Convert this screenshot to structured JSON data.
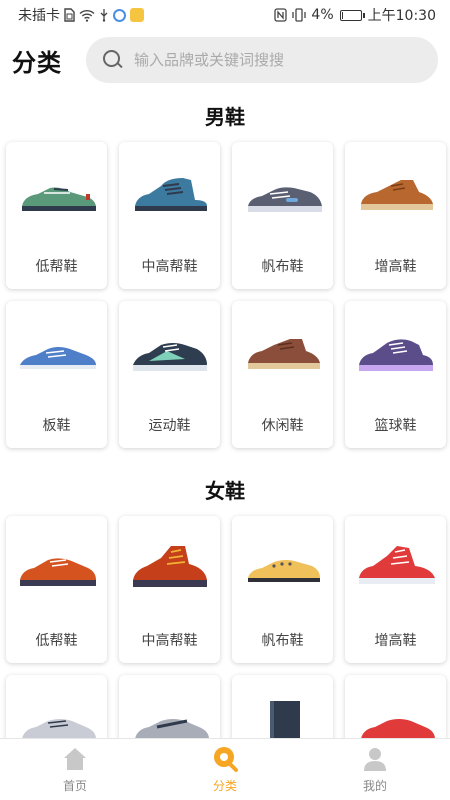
{
  "status_bar": {
    "carrier": "未插卡",
    "battery_pct": "4%",
    "battery_level": 0.04,
    "time": "上午10:30"
  },
  "header": {
    "title": "分类",
    "search_placeholder": "输入品牌或关键词搜搜"
  },
  "sections": [
    {
      "title": "男鞋",
      "items": [
        {
          "label": "低帮鞋",
          "icon": "low-top-sneaker-icon"
        },
        {
          "label": "中高帮鞋",
          "icon": "mid-top-sneaker-icon"
        },
        {
          "label": "帆布鞋",
          "icon": "canvas-shoe-icon"
        },
        {
          "label": "增高鞋",
          "icon": "elevator-shoe-icon"
        },
        {
          "label": "板鞋",
          "icon": "skate-shoe-icon"
        },
        {
          "label": "运动鞋",
          "icon": "running-shoe-icon"
        },
        {
          "label": "休闲鞋",
          "icon": "casual-shoe-icon"
        },
        {
          "label": "篮球鞋",
          "icon": "basketball-shoe-icon"
        }
      ]
    },
    {
      "title": "女鞋",
      "items": [
        {
          "label": "低帮鞋",
          "icon": "low-top-shoe-icon"
        },
        {
          "label": "中高帮鞋",
          "icon": "mid-top-boot-icon"
        },
        {
          "label": "帆布鞋",
          "icon": "canvas-shoe-icon"
        },
        {
          "label": "增高鞋",
          "icon": "high-top-sneaker-icon"
        },
        {
          "label": "",
          "icon": "sneaker-icon"
        },
        {
          "label": "",
          "icon": "sneaker-icon"
        },
        {
          "label": "",
          "icon": "boot-icon"
        },
        {
          "label": "",
          "icon": "sneaker-icon"
        }
      ]
    }
  ],
  "bottom_nav": [
    {
      "label": "首页",
      "icon": "home-icon",
      "active": false
    },
    {
      "label": "分类",
      "icon": "category-search-icon",
      "active": true
    },
    {
      "label": "我的",
      "icon": "user-icon",
      "active": false
    }
  ],
  "colors": {
    "accent": "#f5a623",
    "nav_inactive": "#cccccc"
  }
}
